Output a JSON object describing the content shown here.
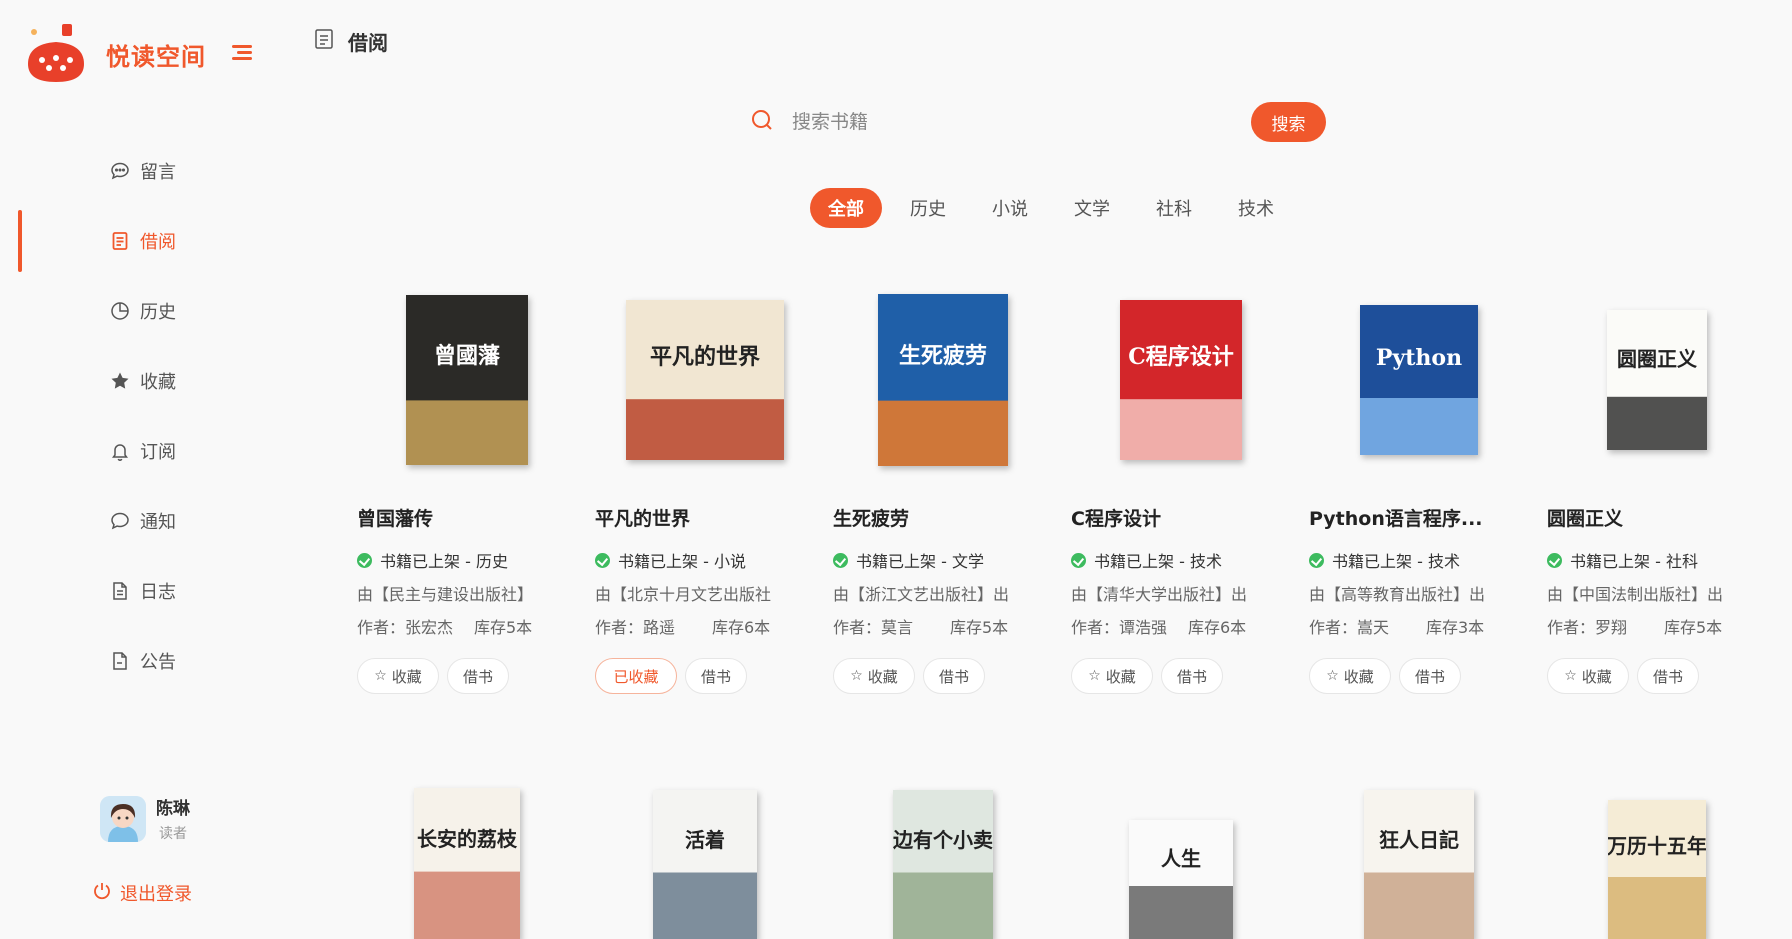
{
  "app": {
    "name": "悦读空间"
  },
  "sidebar": {
    "items": [
      {
        "label": "留言",
        "icon": "chat-bubble-icon",
        "active": false
      },
      {
        "label": "借阅",
        "icon": "document-icon",
        "active": true
      },
      {
        "label": "历史",
        "icon": "pie-chart-icon",
        "active": false
      },
      {
        "label": "收藏",
        "icon": "star-icon",
        "active": false
      },
      {
        "label": "订阅",
        "icon": "bell-icon",
        "active": false
      },
      {
        "label": "通知",
        "icon": "message-icon",
        "active": false
      },
      {
        "label": "日志",
        "icon": "log-icon",
        "active": false
      },
      {
        "label": "公告",
        "icon": "notice-icon",
        "active": false
      }
    ],
    "user": {
      "name": "陈琳",
      "role": "读者"
    },
    "logout_label": "退出登录"
  },
  "header": {
    "title": "借阅"
  },
  "search": {
    "placeholder": "搜索书籍",
    "value": "",
    "button_label": "搜索"
  },
  "categories": [
    "全部",
    "历史",
    "小说",
    "文学",
    "社科",
    "技术"
  ],
  "active_category": "全部",
  "books": [
    {
      "title": "曾国藩传",
      "status": "书籍已上架 - 历史",
      "publisher": "由【民主与建设出版社】",
      "author": "作者：张宏杰",
      "stock": "库存5本",
      "fav_label": "收藏",
      "faved": false,
      "borrow_label": "借书",
      "cover_text": "曾國藩",
      "cover_color": "#2b2a27",
      "cover_accent": "#c9a35a"
    },
    {
      "title": "平凡的世界",
      "status": "书籍已上架 - 小说",
      "publisher": "由【北京十月文艺出版社",
      "author": "作者：路遥",
      "stock": "库存6本",
      "fav_label": "已收藏",
      "faved": true,
      "borrow_label": "借书",
      "cover_text": "平凡的世界",
      "cover_color": "#f1e6d2",
      "cover_accent": "#b8432a"
    },
    {
      "title": "生死疲劳",
      "status": "书籍已上架 - 文学",
      "publisher": "由【浙江文艺出版社】出",
      "author": "作者：莫言",
      "stock": "库存5本",
      "fav_label": "收藏",
      "faved": false,
      "borrow_label": "借书",
      "cover_text": "生死疲劳",
      "cover_color": "#1f5fa8",
      "cover_accent": "#ee7b26"
    },
    {
      "title": "C程序设计",
      "status": "书籍已上架 - 技术",
      "publisher": "由【清华大学出版社】出",
      "author": "作者：谭浩强",
      "stock": "库存6本",
      "fav_label": "收藏",
      "faved": false,
      "borrow_label": "借书",
      "cover_text": "C程序设计",
      "cover_color": "#d3262a",
      "cover_accent": "#f5c6c0"
    },
    {
      "title": "Python语言程序...",
      "status": "书籍已上架 - 技术",
      "publisher": "由【高等教育出版社】出",
      "author": "作者：嵩天",
      "stock": "库存3本",
      "fav_label": "收藏",
      "faved": false,
      "borrow_label": "借书",
      "cover_text": "Python",
      "cover_color": "#1e4f9a",
      "cover_accent": "#7fb4ec"
    },
    {
      "title": "圆圈正义",
      "status": "书籍已上架 - 社科",
      "publisher": "由【中国法制出版社】出",
      "author": "作者：罗翔",
      "stock": "库存5本",
      "fav_label": "收藏",
      "faved": false,
      "borrow_label": "借书",
      "cover_text": "圆圈正义",
      "cover_color": "#fbfbf8",
      "cover_accent": "#333333"
    }
  ],
  "books_row2": [
    {
      "cover_text": "长安的荔枝",
      "cover_color": "#f6f2ea",
      "cover_accent": "#c0462a"
    },
    {
      "cover_text": "活着",
      "cover_color": "#f4f4f2",
      "cover_accent": "#1d3a55"
    },
    {
      "cover_text": "云边有个小卖部",
      "cover_color": "#dfe7e0",
      "cover_accent": "#6c8a5f"
    },
    {
      "cover_text": "人生",
      "cover_color": "#fafafa",
      "cover_accent": "#111111"
    },
    {
      "cover_text": "狂人日記",
      "cover_color": "#f7f4ee",
      "cover_accent": "#b07a52"
    },
    {
      "cover_text": "万历十五年",
      "cover_color": "#f5ecd6",
      "cover_accent": "#c7953a"
    }
  ]
}
